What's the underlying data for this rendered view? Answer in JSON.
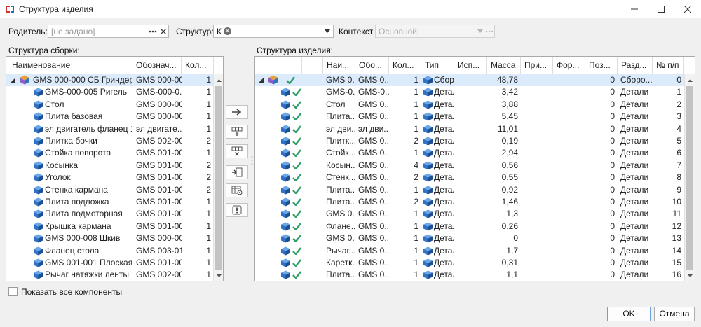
{
  "window": {
    "title": "Структура изделия"
  },
  "form": {
    "parent_label": "Родитель:",
    "parent_placeholder": "[не задано]",
    "structure_label": "Структура",
    "structure_value": "К",
    "context_label": "Контекст",
    "context_value": "Основной"
  },
  "left": {
    "title": "Структура сборки:",
    "columns": [
      "Наименование",
      "Обознач...",
      "Кол..."
    ],
    "rows": [
      {
        "name": "GMS 000-000 СБ Гриндер",
        "code": "GMS 000-00...",
        "qty": "1",
        "root": true
      },
      {
        "name": "GMS-000-005 Ригель",
        "code": "GMS-000-0...",
        "qty": "1"
      },
      {
        "name": "Стол",
        "code": "GMS 000-001",
        "qty": "1"
      },
      {
        "name": "Плита базовая",
        "code": "GMS 000-002",
        "qty": "1"
      },
      {
        "name": "эл двигатель фланец 1,1...",
        "code": "эл двигате...",
        "qty": "1"
      },
      {
        "name": "Плитка бочки",
        "code": "GMS 002-002",
        "qty": "2"
      },
      {
        "name": "Стойка поворота",
        "code": "GMS 001-003",
        "qty": "1"
      },
      {
        "name": "Косынка",
        "code": "GMS 001-004",
        "qty": "2"
      },
      {
        "name": "Уголок",
        "code": "GMS 001-004",
        "qty": "2"
      },
      {
        "name": "Стенка кармана",
        "code": "GMS 001-006",
        "qty": "2"
      },
      {
        "name": "Плита подложка",
        "code": "GMS 001-007",
        "qty": "1"
      },
      {
        "name": "Плита подмоторная",
        "code": "GMS 001-005",
        "qty": "1"
      },
      {
        "name": "Крышка кармана",
        "code": "GMS 001-005",
        "qty": "1"
      },
      {
        "name": "GMS 000-008 Шкив",
        "code": "GMS 000-00...",
        "qty": "1"
      },
      {
        "name": "Фланец стола",
        "code": "GMS 003-011",
        "qty": "1"
      },
      {
        "name": "GMS 001-001 Плоская н...",
        "code": "GMS 001-00...",
        "qty": "1"
      },
      {
        "name": "Рычаг натяжки ленты",
        "code": "GMS 002-001",
        "qty": "1"
      }
    ]
  },
  "right": {
    "title": "Структура изделия:",
    "columns": [
      "Наи...",
      "Обо...",
      "Кол...",
      "Тип",
      "Исп...",
      "Масса",
      "При...",
      "Фор...",
      "Поз...",
      "Разд...",
      "№ п/п"
    ],
    "rows": [
      {
        "name": "GMS 0...",
        "code": "GMS 0...",
        "qty": "1",
        "type": "Сборо",
        "mass": "48,78",
        "pos": "0",
        "section": "Сборо...",
        "npp": "0",
        "root": true
      },
      {
        "name": "GMS-0...",
        "code": "GMS-0...",
        "qty": "1",
        "type": "Детали",
        "mass": "3,42",
        "pos": "0",
        "section": "Детали",
        "npp": "1"
      },
      {
        "name": "Стол",
        "code": "GMS 0...",
        "qty": "1",
        "type": "Детали",
        "mass": "3,88",
        "pos": "0",
        "section": "Детали",
        "npp": "2"
      },
      {
        "name": "Плита...",
        "code": "GMS 0...",
        "qty": "1",
        "type": "Детали",
        "mass": "5,45",
        "pos": "0",
        "section": "Детали",
        "npp": "3"
      },
      {
        "name": "эл дви...",
        "code": "эл дви...",
        "qty": "1",
        "type": "Детали",
        "mass": "11,01",
        "pos": "0",
        "section": "Детали",
        "npp": "4"
      },
      {
        "name": "Плитк...",
        "code": "GMS 0...",
        "qty": "2",
        "type": "Детали",
        "mass": "0,19",
        "pos": "0",
        "section": "Детали",
        "npp": "5"
      },
      {
        "name": "Стойк...",
        "code": "GMS 0...",
        "qty": "1",
        "type": "Детали",
        "mass": "2,94",
        "pos": "0",
        "section": "Детали",
        "npp": "6"
      },
      {
        "name": "Косын...",
        "code": "GMS 0...",
        "qty": "4",
        "type": "Детали",
        "mass": "0,56",
        "pos": "0",
        "section": "Детали",
        "npp": "7"
      },
      {
        "name": "Стенк...",
        "code": "GMS 0...",
        "qty": "2",
        "type": "Детали",
        "mass": "0,55",
        "pos": "0",
        "section": "Детали",
        "npp": "8"
      },
      {
        "name": "Плита...",
        "code": "GMS 0...",
        "qty": "1",
        "type": "Детали",
        "mass": "0,92",
        "pos": "0",
        "section": "Детали",
        "npp": "9"
      },
      {
        "name": "Плита...",
        "code": "GMS 0...",
        "qty": "2",
        "type": "Детали",
        "mass": "1,46",
        "pos": "0",
        "section": "Детали",
        "npp": "10"
      },
      {
        "name": "GMS 0...",
        "code": "GMS 0...",
        "qty": "1",
        "type": "Детали",
        "mass": "1,3",
        "pos": "0",
        "section": "Детали",
        "npp": "11"
      },
      {
        "name": "Флане...",
        "code": "GMS 0...",
        "qty": "1",
        "type": "Детали",
        "mass": "0,26",
        "pos": "0",
        "section": "Детали",
        "npp": "12"
      },
      {
        "name": "GMS 0...",
        "code": "GMS 0...",
        "qty": "1",
        "type": "Детали",
        "mass": "0",
        "pos": "0",
        "section": "Детали",
        "npp": "13"
      },
      {
        "name": "Рычаг...",
        "code": "GMS 0...",
        "qty": "1",
        "type": "Детали",
        "mass": "1,7",
        "pos": "0",
        "section": "Детали",
        "npp": "14"
      },
      {
        "name": "Каретк...",
        "code": "GMS 0...",
        "qty": "1",
        "type": "Детали",
        "mass": "0,31",
        "pos": "0",
        "section": "Детали",
        "npp": "15"
      },
      {
        "name": "Плита...",
        "code": "GMS 0...",
        "qty": "1",
        "type": "Детали",
        "mass": "1,1",
        "pos": "0",
        "section": "Детали",
        "npp": "16"
      }
    ]
  },
  "show_all_label": "Показать все компоненты",
  "buttons": {
    "ok": "OK",
    "cancel": "Отмена"
  },
  "colors": {
    "selection": "#dcebfc",
    "part_icon": "#2f73c6",
    "check_icon": "#2e9e6b",
    "assembly_icon": "#e6a13a"
  }
}
